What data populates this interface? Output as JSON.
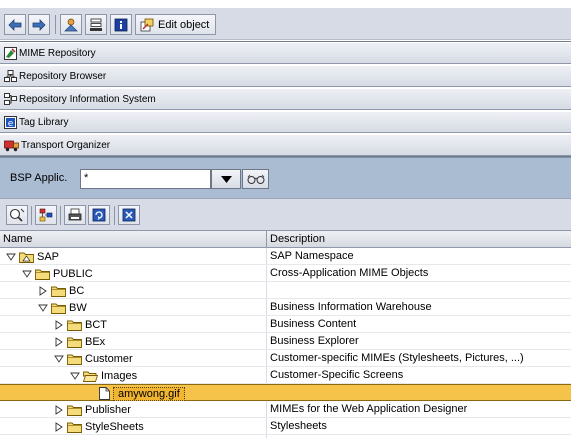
{
  "app_toolbar": {
    "edit_object_label": "Edit object"
  },
  "nav_panels": [
    {
      "label": "MIME Repository",
      "icon": "mime-repository-icon"
    },
    {
      "label": "Repository Browser",
      "icon": "repository-browser-icon"
    },
    {
      "label": "Repository Information System",
      "icon": "repository-info-icon"
    },
    {
      "label": "Tag Library",
      "icon": "tag-library-icon"
    },
    {
      "label": "Transport Organizer",
      "icon": "truck-icon"
    }
  ],
  "selection": {
    "label": "BSP Applic.",
    "value": "*"
  },
  "tree": {
    "col_name": "Name",
    "col_description": "Description",
    "rows": [
      {
        "name": "SAP",
        "desc": "SAP Namespace",
        "level": 0,
        "expand": "open",
        "icon": "namespace-folder-icon"
      },
      {
        "name": "PUBLIC",
        "desc": "Cross-Application MIME Objects",
        "level": 1,
        "expand": "open",
        "icon": "folder-icon"
      },
      {
        "name": "BC",
        "desc": "",
        "level": 2,
        "expand": "closed",
        "icon": "folder-icon"
      },
      {
        "name": "BW",
        "desc": "Business Information Warehouse",
        "level": 2,
        "expand": "open",
        "icon": "folder-icon"
      },
      {
        "name": "BCT",
        "desc": "Business Content",
        "level": 3,
        "expand": "closed",
        "icon": "folder-icon"
      },
      {
        "name": "BEx",
        "desc": "Business Explorer",
        "level": 3,
        "expand": "closed",
        "icon": "folder-icon"
      },
      {
        "name": "Customer",
        "desc": "Customer-specific MIMEs (Stylesheets, Pictures, ...)",
        "level": 3,
        "expand": "open",
        "icon": "folder-icon"
      },
      {
        "name": "Images",
        "desc": "Customer-Specific Screens",
        "level": 4,
        "expand": "open",
        "icon": "open-folder-icon"
      },
      {
        "name": "amywong.gif",
        "desc": "",
        "level": 5,
        "expand": "none",
        "icon": "file-icon",
        "selected": true
      },
      {
        "name": "Publisher",
        "desc": "MIMEs for the Web Application Designer",
        "level": 3,
        "expand": "closed",
        "icon": "folder-icon"
      },
      {
        "name": "StyleSheets",
        "desc": "Stylesheets",
        "level": 3,
        "expand": "closed",
        "icon": "folder-icon"
      }
    ]
  }
}
